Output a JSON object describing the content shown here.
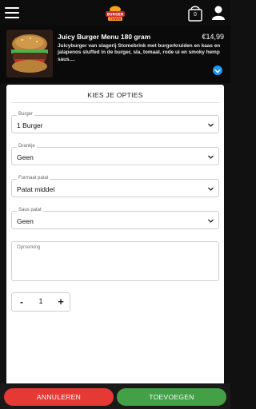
{
  "header": {
    "logo_text": "BURGER TOWN",
    "cart_count": "0"
  },
  "product": {
    "title": "Juicy Burger Menu 180 gram",
    "price": "€14,99",
    "description": "Juicyburger van slagerij Stomebrink met burgerkruiden en kaas en jalapenos stuffed in de burger, sla, tomaat, rode ui en smoky hemp saus...."
  },
  "modal": {
    "title": "KIES JE OPTIES",
    "fields": [
      {
        "label": "Burger",
        "value": "1 Burger"
      },
      {
        "label": "Drankje",
        "value": "Geen"
      },
      {
        "label": "Formaat patat",
        "value": "Patat middel"
      },
      {
        "label": "Saus patat",
        "value": "Geen"
      }
    ],
    "remark_label": "Opmerking",
    "quantity": {
      "minus": "-",
      "value": "1",
      "plus": "+"
    }
  },
  "footer": {
    "cancel_label": "ANNULEREN",
    "add_label": "TOEVOEGEN"
  },
  "colors": {
    "cancel": "#e53935",
    "add": "#43a047",
    "accent": "#2196f3",
    "logo": "#f6a21a"
  }
}
